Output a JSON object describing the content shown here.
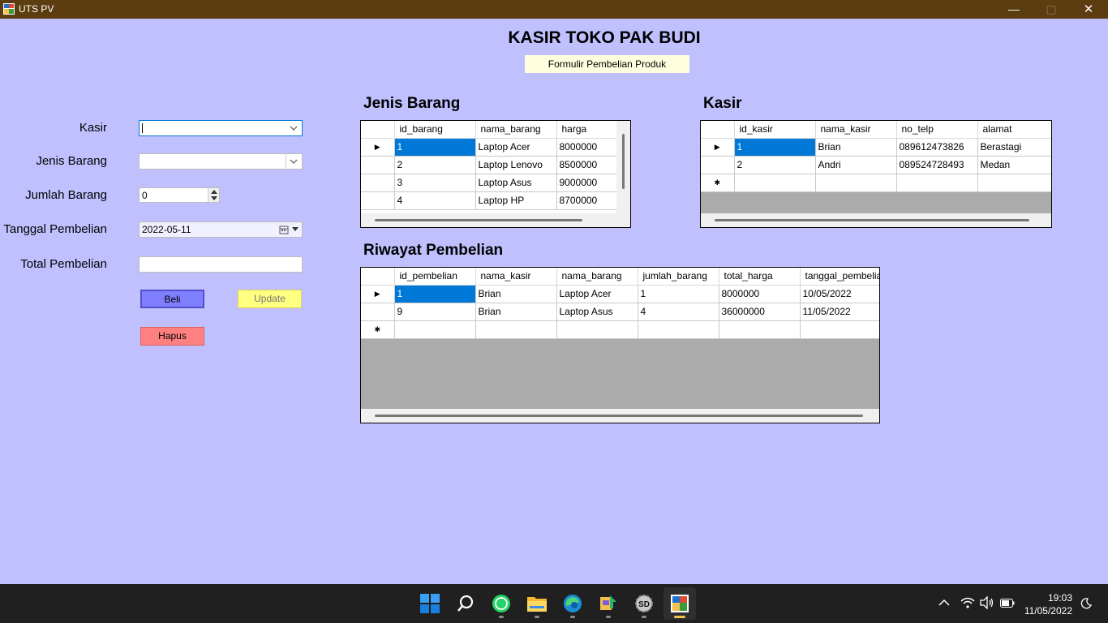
{
  "window": {
    "title": "UTS PV",
    "minimize_glyph": "—",
    "maximize_glyph": "▢",
    "close_glyph": "✕"
  },
  "header": {
    "title": "KASIR TOKO PAK BUDI",
    "subtitle": "Formulir Pembelian Produk"
  },
  "form": {
    "kasir_label": "Kasir",
    "kasir_value": "",
    "jenis_barang_label": "Jenis Barang",
    "jenis_barang_value": "",
    "jumlah_barang_label": "Jumlah Barang",
    "jumlah_barang_value": "0",
    "tanggal_label": "Tanggal Pembelian",
    "tanggal_value": "2022-05-11",
    "total_label": "Total Pembelian",
    "total_value": ""
  },
  "buttons": {
    "beli": "Beli",
    "update": "Update",
    "hapus": "Hapus"
  },
  "colors": {
    "form_bg": "#c0c0ff",
    "titlebar_bg": "#5c3d10",
    "beli_bg": "#8080ff",
    "update_bg": "#ffff80",
    "hapus_bg": "#ff8080",
    "selection": "#0078d7"
  },
  "jenis_barang_grid": {
    "title": "Jenis Barang",
    "columns": [
      "id_barang",
      "nama_barang",
      "harga"
    ],
    "rows": [
      [
        "1",
        "Laptop Acer",
        "8000000"
      ],
      [
        "2",
        "Laptop Lenovo",
        "8500000"
      ],
      [
        "3",
        "Laptop Asus",
        "9000000"
      ],
      [
        "4",
        "Laptop HP",
        "8700000"
      ]
    ]
  },
  "kasir_grid": {
    "title": "Kasir",
    "columns": [
      "id_kasir",
      "nama_kasir",
      "no_telp",
      "alamat"
    ],
    "rows": [
      [
        "1",
        "Brian",
        "089612473826",
        "Berastagi"
      ],
      [
        "2",
        "Andri",
        "089524728493",
        "Medan"
      ]
    ]
  },
  "riwayat_grid": {
    "title": "Riwayat Pembelian",
    "columns": [
      "id_pembelian",
      "nama_kasir",
      "nama_barang",
      "jumlah_barang",
      "total_harga",
      "tanggal_pembelian"
    ],
    "rows": [
      [
        "1",
        "Brian",
        "Laptop Acer",
        "1",
        "8000000",
        "10/05/2022"
      ],
      [
        "9",
        "Brian",
        "Laptop Asus",
        "4",
        "36000000",
        "11/05/2022"
      ]
    ]
  },
  "taskbar": {
    "apps": [
      "start-icon",
      "search-icon",
      "whatsapp-icon",
      "file-explorer-icon",
      "edge-icon",
      "visual-studio-installer-icon",
      "sd-tool-icon",
      "uts-pv-app-icon"
    ],
    "time": "19:03",
    "date": "11/05/2022"
  }
}
